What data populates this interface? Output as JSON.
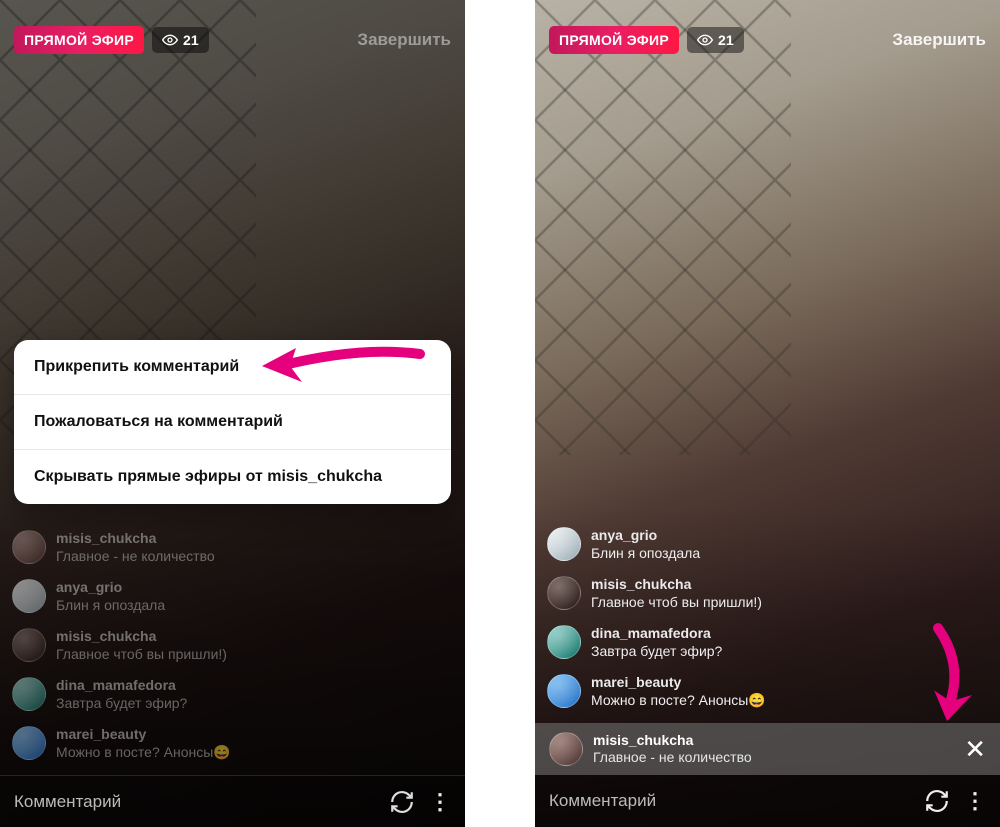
{
  "accent_pink": "#e5007e",
  "left": {
    "live_badge": "ПРЯМОЙ ЭФИР",
    "viewer_count": "21",
    "end_label": "Завершить",
    "comment_input_placeholder": "Комментарий",
    "context_menu": {
      "pin": "Прикрепить комментарий",
      "report": "Пожаловаться на комментарий",
      "hide": "Скрывать прямые эфиры от misis_chukcha"
    },
    "comments": [
      {
        "user": "misis_chukcha",
        "msg": "Главное - не количество"
      },
      {
        "user": "anya_grio",
        "msg": "Блин я опоздала"
      },
      {
        "user": "misis_chukcha",
        "msg": "Главное чтоб вы пришли!)"
      },
      {
        "user": "dina_mamafedora",
        "msg": "Завтра будет эфир?"
      },
      {
        "user": "marei_beauty",
        "msg": "Можно в посте? Анонсы😄"
      }
    ]
  },
  "right": {
    "live_badge": "ПРЯМОЙ ЭФИР",
    "viewer_count": "21",
    "end_label": "Завершить",
    "comment_input_placeholder": "Комментарий",
    "comments": [
      {
        "user": "anya_grio",
        "msg": "Блин я опоздала"
      },
      {
        "user": "misis_chukcha",
        "msg": "Главное чтоб вы пришли!)"
      },
      {
        "user": "dina_mamafedora",
        "msg": "Завтра будет эфир?"
      },
      {
        "user": "marei_beauty",
        "msg": "Можно в посте? Анонсы😄"
      }
    ],
    "pinned": {
      "user": "misis_chukcha",
      "msg": "Главное - не количество"
    }
  }
}
